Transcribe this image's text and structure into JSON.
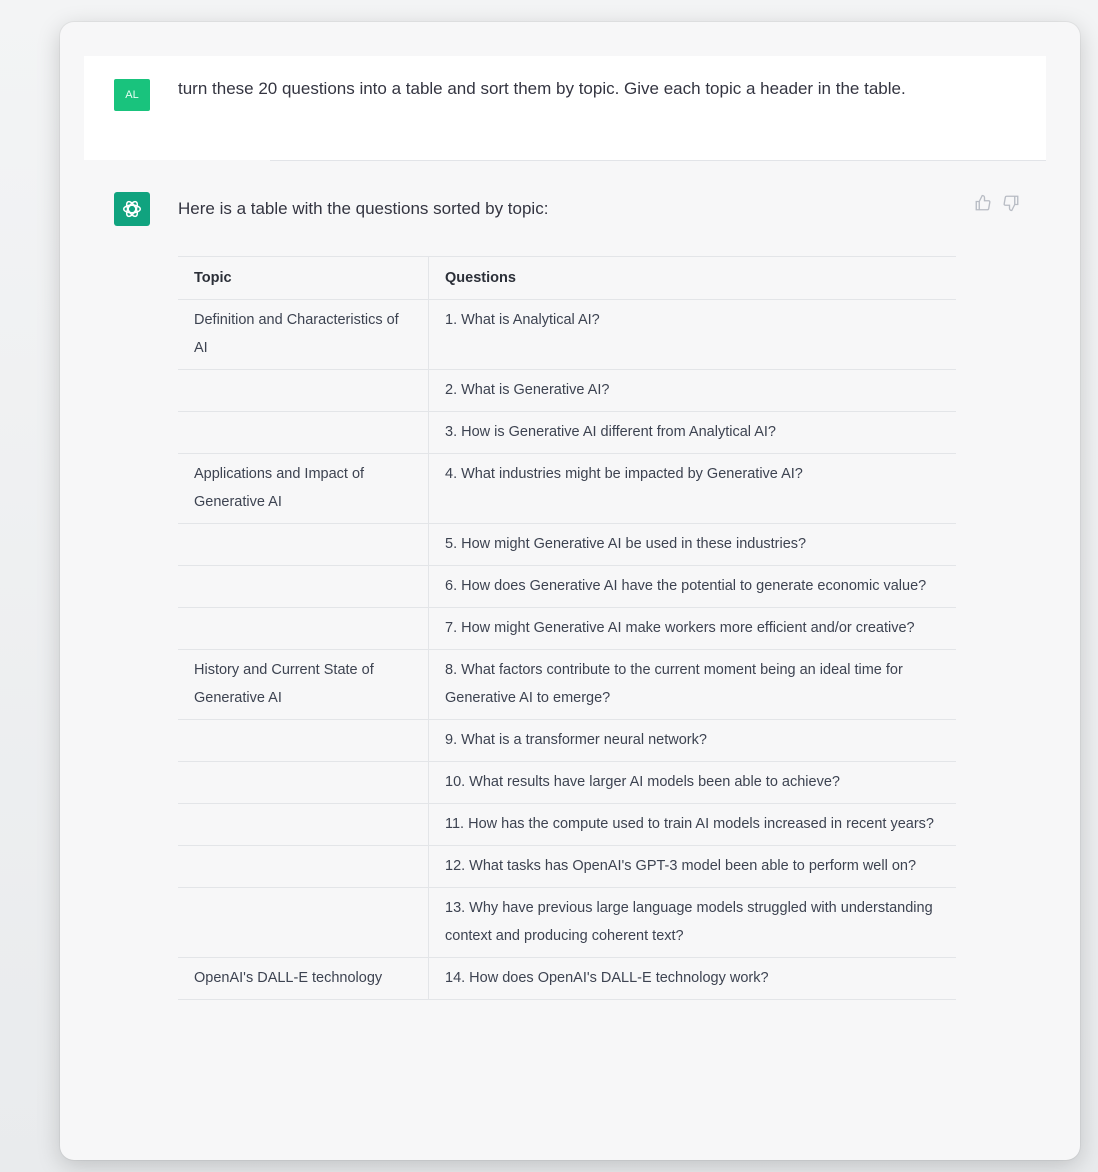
{
  "user": {
    "avatar_initials": "AL",
    "message": "turn these 20 questions into a table and sort them by topic. Give each topic a header in the table."
  },
  "assistant": {
    "intro": "Here is a table with the questions sorted by topic:",
    "icons": {
      "avatar": "openai-logo-icon",
      "like": "thumbs-up-icon",
      "dislike": "thumbs-down-icon"
    },
    "table": {
      "headers": [
        "Topic",
        "Questions"
      ],
      "rows": [
        {
          "topic": "Definition and Characteristics of AI",
          "question": "1. What is Analytical AI?"
        },
        {
          "topic": "",
          "question": "2. What is Generative AI?"
        },
        {
          "topic": "",
          "question": "3. How is Generative AI different from Analytical AI?"
        },
        {
          "topic": "Applications and Impact of Generative AI",
          "question": "4. What industries might be impacted by Generative AI?"
        },
        {
          "topic": "",
          "question": "5. How might Generative AI be used in these industries?"
        },
        {
          "topic": "",
          "question": "6. How does Generative AI have the potential to generate economic value?"
        },
        {
          "topic": "",
          "question": "7. How might Generative AI make workers more efficient and/or creative?"
        },
        {
          "topic": "History and Current State of Generative AI",
          "question": "8. What factors contribute to the current moment being an ideal time for Generative AI to emerge?"
        },
        {
          "topic": "",
          "question": "9. What is a transformer neural network?"
        },
        {
          "topic": "",
          "question": "10. What results have larger AI models been able to achieve?"
        },
        {
          "topic": "",
          "question": "11. How has the compute used to train AI models increased in recent years?"
        },
        {
          "topic": "",
          "question": "12. What tasks has OpenAI's GPT-3 model been able to perform well on?"
        },
        {
          "topic": "",
          "question": "13. Why have previous large language models struggled with understanding context and producing coherent text?"
        },
        {
          "topic": "OpenAI's DALL-E technology",
          "question": "14. How does OpenAI's DALL-E technology work?"
        }
      ]
    }
  },
  "colors": {
    "user_avatar": "#19c37d",
    "assistant_avatar": "#10a37f",
    "background": "#f7f7f8"
  }
}
